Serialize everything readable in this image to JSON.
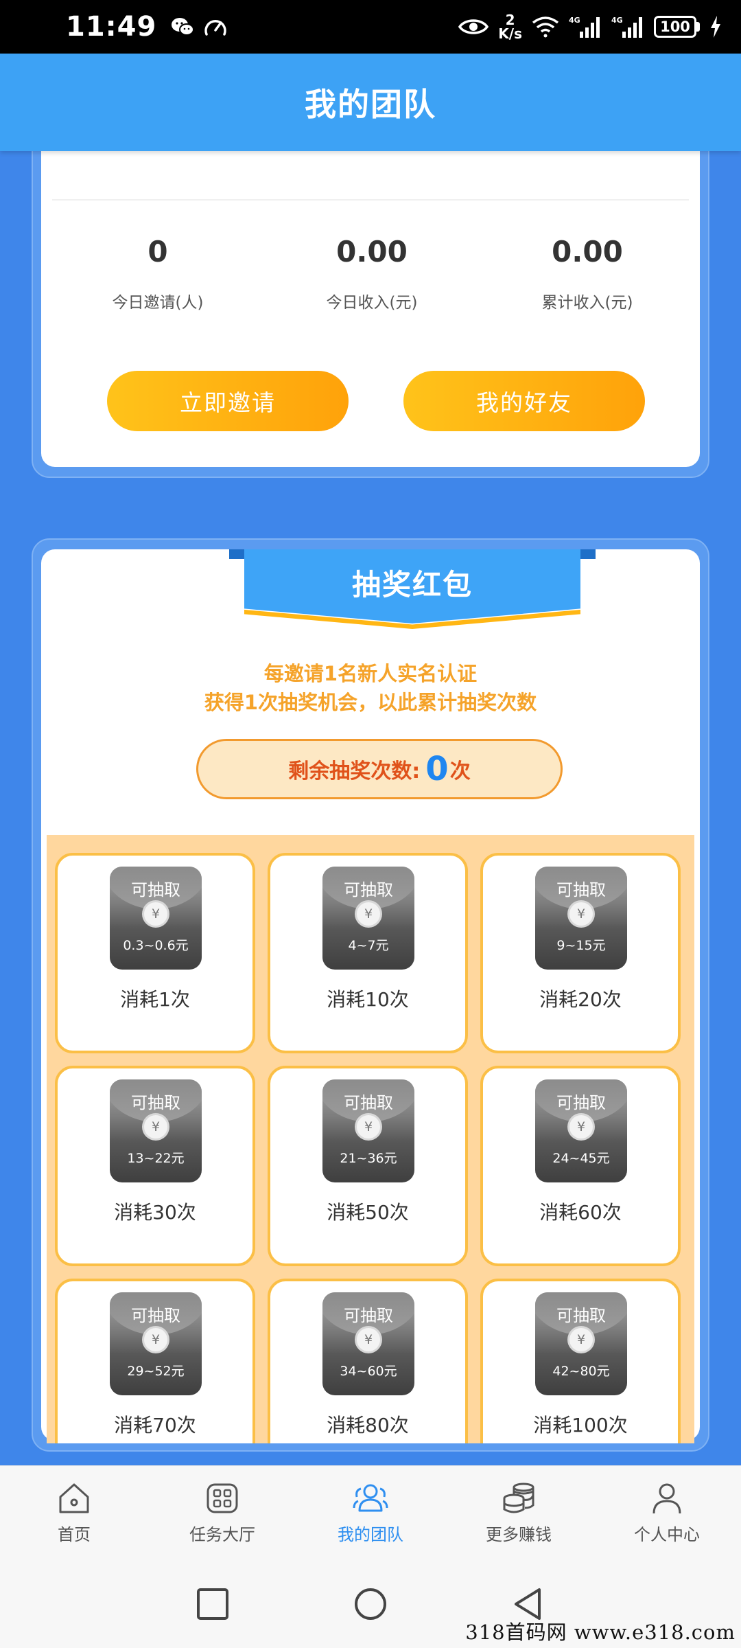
{
  "status_bar": {
    "time": "11:49",
    "net_speed_value": "2",
    "net_speed_unit": "K/s",
    "network_label": "4G",
    "battery": "100",
    "icons": [
      "wechat-icon",
      "speedometer-icon",
      "eye-icon",
      "wifi-icon",
      "signal-icon",
      "battery-icon",
      "charging-icon"
    ]
  },
  "header": {
    "title": "我的团队"
  },
  "stats": {
    "items": [
      {
        "value": "0",
        "label": "今日邀请(人)"
      },
      {
        "value": "0.00",
        "label": "今日收入(元)"
      },
      {
        "value": "0.00",
        "label": "累计收入(元)"
      }
    ],
    "invite_button": "立即邀请",
    "friends_button": "我的好友"
  },
  "lottery": {
    "title": "抽奖红包",
    "rule_line1": "每邀请1名新人实名认证",
    "rule_line2": "获得1次抽奖机会，以此累计抽奖次数",
    "remaining_label": "剩余抽奖次数:",
    "remaining_count": "0",
    "remaining_unit": "次",
    "envelope_title": "可抽取",
    "coin_symbol": "¥",
    "prizes": [
      {
        "range": "0.3~0.6元",
        "cost": "消耗1次"
      },
      {
        "range": "4~7元",
        "cost": "消耗10次"
      },
      {
        "range": "9~15元",
        "cost": "消耗20次"
      },
      {
        "range": "13~22元",
        "cost": "消耗30次"
      },
      {
        "range": "21~36元",
        "cost": "消耗50次"
      },
      {
        "range": "24~45元",
        "cost": "消耗60次"
      },
      {
        "range": "29~52元",
        "cost": "消耗70次"
      },
      {
        "range": "34~60元",
        "cost": "消耗80次"
      },
      {
        "range": "42~80元",
        "cost": "消耗100次"
      }
    ]
  },
  "bottom_nav": {
    "items": [
      {
        "label": "首页",
        "icon": "home-icon"
      },
      {
        "label": "任务大厅",
        "icon": "grid-icon"
      },
      {
        "label": "我的团队",
        "icon": "team-icon",
        "active": true
      },
      {
        "label": "更多赚钱",
        "icon": "coins-icon"
      },
      {
        "label": "个人中心",
        "icon": "person-icon"
      }
    ]
  },
  "watermark": "318首码网  www.e318.com",
  "colors": {
    "header_blue": "#3da2f5",
    "page_blue": "#3f86ea",
    "button_orange": "#ffa20a",
    "rule_orange": "#f5a32a",
    "count_blue": "#1f86f0",
    "active_nav": "#2f8ff0"
  }
}
